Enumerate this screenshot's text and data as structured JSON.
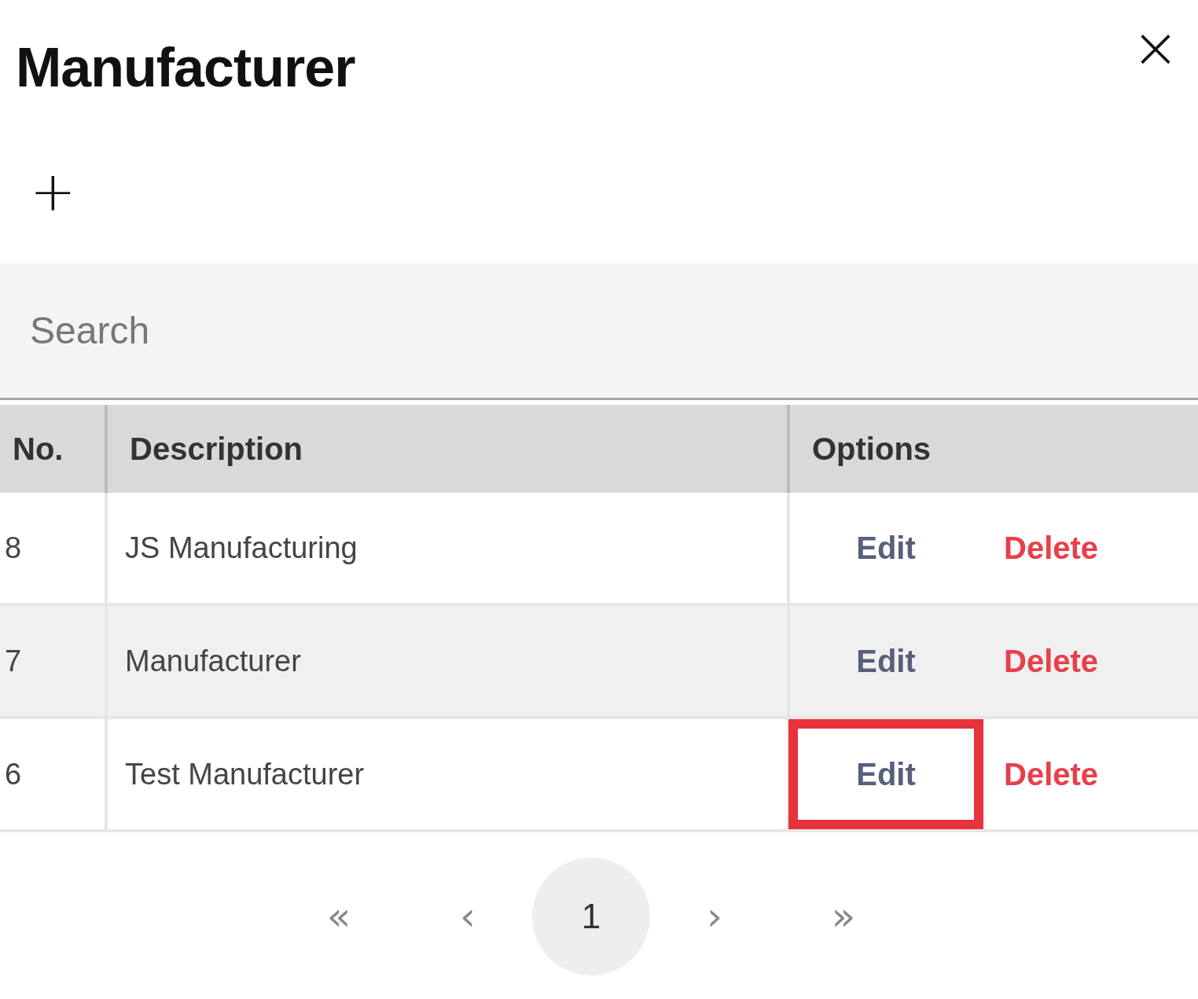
{
  "dialog": {
    "title": "Manufacturer",
    "close": "×",
    "add": "+"
  },
  "search": {
    "placeholder": "Search"
  },
  "table": {
    "columns": [
      "No.",
      "Description",
      "Options"
    ],
    "rows": [
      {
        "no": "8",
        "description": "JS Manufacturing",
        "edit": "Edit",
        "delete": "Delete",
        "highlighted": false
      },
      {
        "no": "7",
        "description": "Manufacturer",
        "edit": "Edit",
        "delete": "Delete",
        "highlighted": false
      },
      {
        "no": "6",
        "description": "Test Manufacturer",
        "edit": "Edit",
        "delete": "Delete",
        "highlighted": true
      }
    ]
  },
  "pagination": {
    "first": "«",
    "prev": "‹",
    "pages": [
      {
        "label": "1",
        "selected": true
      }
    ],
    "next": "›",
    "last": "»"
  }
}
